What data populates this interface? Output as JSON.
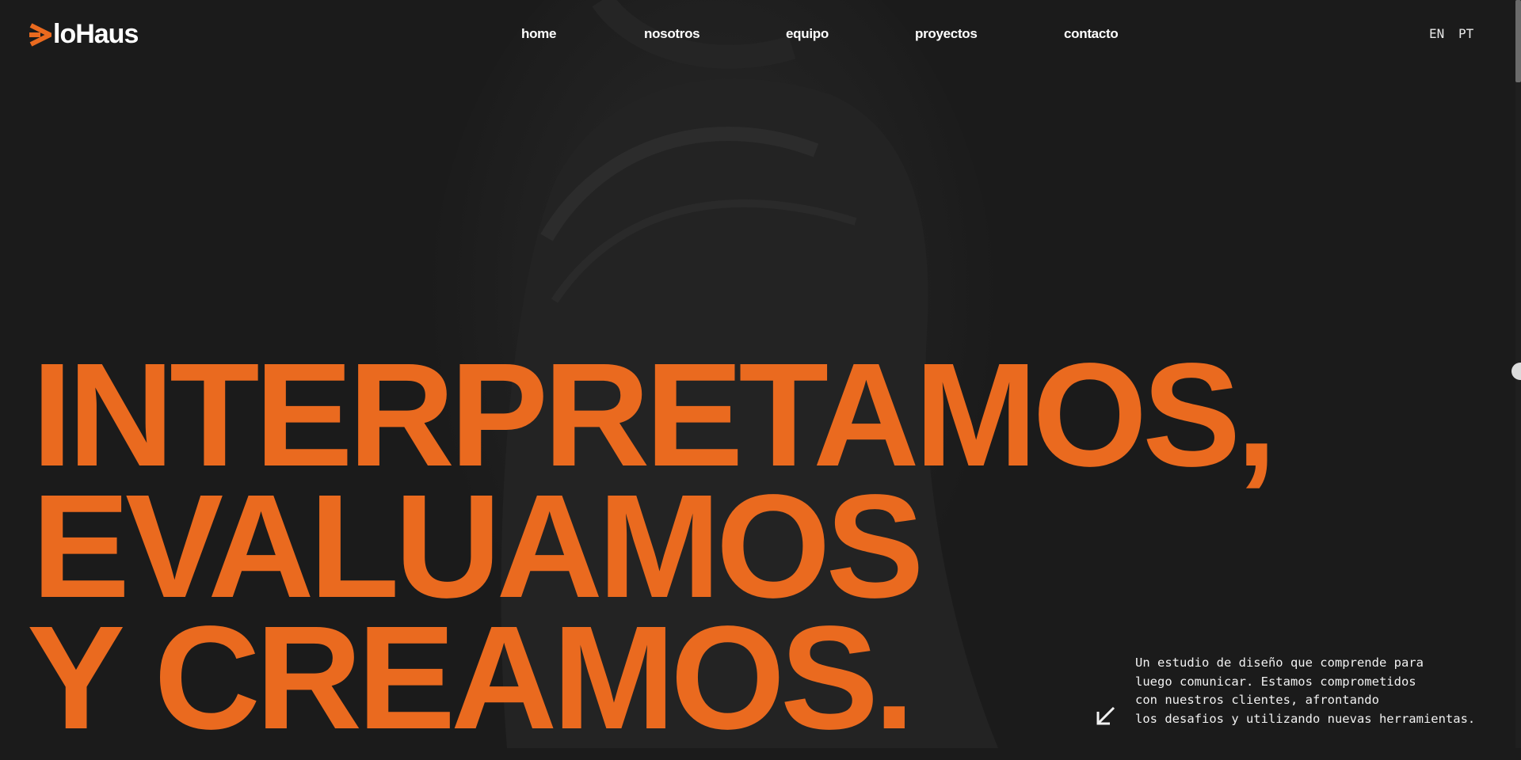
{
  "brand": {
    "logo_text": "loHaus",
    "logo_mark_color": "#ea6a1f",
    "logo_icon": "triangle-logo-mark-icon"
  },
  "nav": {
    "items": [
      {
        "label": "home"
      },
      {
        "label": "nosotros"
      },
      {
        "label": "equipo"
      },
      {
        "label": "proyectos"
      },
      {
        "label": "contacto"
      }
    ]
  },
  "languages": [
    "EN",
    "PT"
  ],
  "hero": {
    "lines": [
      "INTERPRETAMOS,",
      "EVALUAMOS",
      "Y CREAMOS."
    ],
    "accent_color": "#ea6a1f"
  },
  "intro": {
    "arrow_icon": "arrow-down-left-icon",
    "lines": [
      "Un estudio de diseño que comprende para",
      "luego comunicar. Estamos comprometidos",
      "con nuestros clientes, afrontando",
      "los desafios y utilizando nuevas herramientas."
    ]
  },
  "colors": {
    "background": "#1b1b1b",
    "text": "#ffffff",
    "accent": "#ea6a1f"
  }
}
